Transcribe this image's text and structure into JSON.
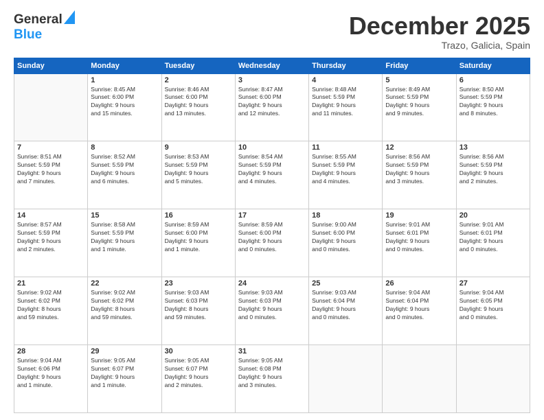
{
  "header": {
    "logo_general": "General",
    "logo_blue": "Blue",
    "month_title": "December 2025",
    "location": "Trazo, Galicia, Spain"
  },
  "weekdays": [
    "Sunday",
    "Monday",
    "Tuesday",
    "Wednesday",
    "Thursday",
    "Friday",
    "Saturday"
  ],
  "weeks": [
    [
      {
        "day": "",
        "info": ""
      },
      {
        "day": "1",
        "info": "Sunrise: 8:45 AM\nSunset: 6:00 PM\nDaylight: 9 hours\nand 15 minutes."
      },
      {
        "day": "2",
        "info": "Sunrise: 8:46 AM\nSunset: 6:00 PM\nDaylight: 9 hours\nand 13 minutes."
      },
      {
        "day": "3",
        "info": "Sunrise: 8:47 AM\nSunset: 6:00 PM\nDaylight: 9 hours\nand 12 minutes."
      },
      {
        "day": "4",
        "info": "Sunrise: 8:48 AM\nSunset: 5:59 PM\nDaylight: 9 hours\nand 11 minutes."
      },
      {
        "day": "5",
        "info": "Sunrise: 8:49 AM\nSunset: 5:59 PM\nDaylight: 9 hours\nand 9 minutes."
      },
      {
        "day": "6",
        "info": "Sunrise: 8:50 AM\nSunset: 5:59 PM\nDaylight: 9 hours\nand 8 minutes."
      }
    ],
    [
      {
        "day": "7",
        "info": "Sunrise: 8:51 AM\nSunset: 5:59 PM\nDaylight: 9 hours\nand 7 minutes."
      },
      {
        "day": "8",
        "info": "Sunrise: 8:52 AM\nSunset: 5:59 PM\nDaylight: 9 hours\nand 6 minutes."
      },
      {
        "day": "9",
        "info": "Sunrise: 8:53 AM\nSunset: 5:59 PM\nDaylight: 9 hours\nand 5 minutes."
      },
      {
        "day": "10",
        "info": "Sunrise: 8:54 AM\nSunset: 5:59 PM\nDaylight: 9 hours\nand 4 minutes."
      },
      {
        "day": "11",
        "info": "Sunrise: 8:55 AM\nSunset: 5:59 PM\nDaylight: 9 hours\nand 4 minutes."
      },
      {
        "day": "12",
        "info": "Sunrise: 8:56 AM\nSunset: 5:59 PM\nDaylight: 9 hours\nand 3 minutes."
      },
      {
        "day": "13",
        "info": "Sunrise: 8:56 AM\nSunset: 5:59 PM\nDaylight: 9 hours\nand 2 minutes."
      }
    ],
    [
      {
        "day": "14",
        "info": "Sunrise: 8:57 AM\nSunset: 5:59 PM\nDaylight: 9 hours\nand 2 minutes."
      },
      {
        "day": "15",
        "info": "Sunrise: 8:58 AM\nSunset: 5:59 PM\nDaylight: 9 hours\nand 1 minute."
      },
      {
        "day": "16",
        "info": "Sunrise: 8:59 AM\nSunset: 6:00 PM\nDaylight: 9 hours\nand 1 minute."
      },
      {
        "day": "17",
        "info": "Sunrise: 8:59 AM\nSunset: 6:00 PM\nDaylight: 9 hours\nand 0 minutes."
      },
      {
        "day": "18",
        "info": "Sunrise: 9:00 AM\nSunset: 6:00 PM\nDaylight: 9 hours\nand 0 minutes."
      },
      {
        "day": "19",
        "info": "Sunrise: 9:01 AM\nSunset: 6:01 PM\nDaylight: 9 hours\nand 0 minutes."
      },
      {
        "day": "20",
        "info": "Sunrise: 9:01 AM\nSunset: 6:01 PM\nDaylight: 9 hours\nand 0 minutes."
      }
    ],
    [
      {
        "day": "21",
        "info": "Sunrise: 9:02 AM\nSunset: 6:02 PM\nDaylight: 8 hours\nand 59 minutes."
      },
      {
        "day": "22",
        "info": "Sunrise: 9:02 AM\nSunset: 6:02 PM\nDaylight: 8 hours\nand 59 minutes."
      },
      {
        "day": "23",
        "info": "Sunrise: 9:03 AM\nSunset: 6:03 PM\nDaylight: 8 hours\nand 59 minutes."
      },
      {
        "day": "24",
        "info": "Sunrise: 9:03 AM\nSunset: 6:03 PM\nDaylight: 9 hours\nand 0 minutes."
      },
      {
        "day": "25",
        "info": "Sunrise: 9:03 AM\nSunset: 6:04 PM\nDaylight: 9 hours\nand 0 minutes."
      },
      {
        "day": "26",
        "info": "Sunrise: 9:04 AM\nSunset: 6:04 PM\nDaylight: 9 hours\nand 0 minutes."
      },
      {
        "day": "27",
        "info": "Sunrise: 9:04 AM\nSunset: 6:05 PM\nDaylight: 9 hours\nand 0 minutes."
      }
    ],
    [
      {
        "day": "28",
        "info": "Sunrise: 9:04 AM\nSunset: 6:06 PM\nDaylight: 9 hours\nand 1 minute."
      },
      {
        "day": "29",
        "info": "Sunrise: 9:05 AM\nSunset: 6:07 PM\nDaylight: 9 hours\nand 1 minute."
      },
      {
        "day": "30",
        "info": "Sunrise: 9:05 AM\nSunset: 6:07 PM\nDaylight: 9 hours\nand 2 minutes."
      },
      {
        "day": "31",
        "info": "Sunrise: 9:05 AM\nSunset: 6:08 PM\nDaylight: 9 hours\nand 3 minutes."
      },
      {
        "day": "",
        "info": ""
      },
      {
        "day": "",
        "info": ""
      },
      {
        "day": "",
        "info": ""
      }
    ]
  ]
}
